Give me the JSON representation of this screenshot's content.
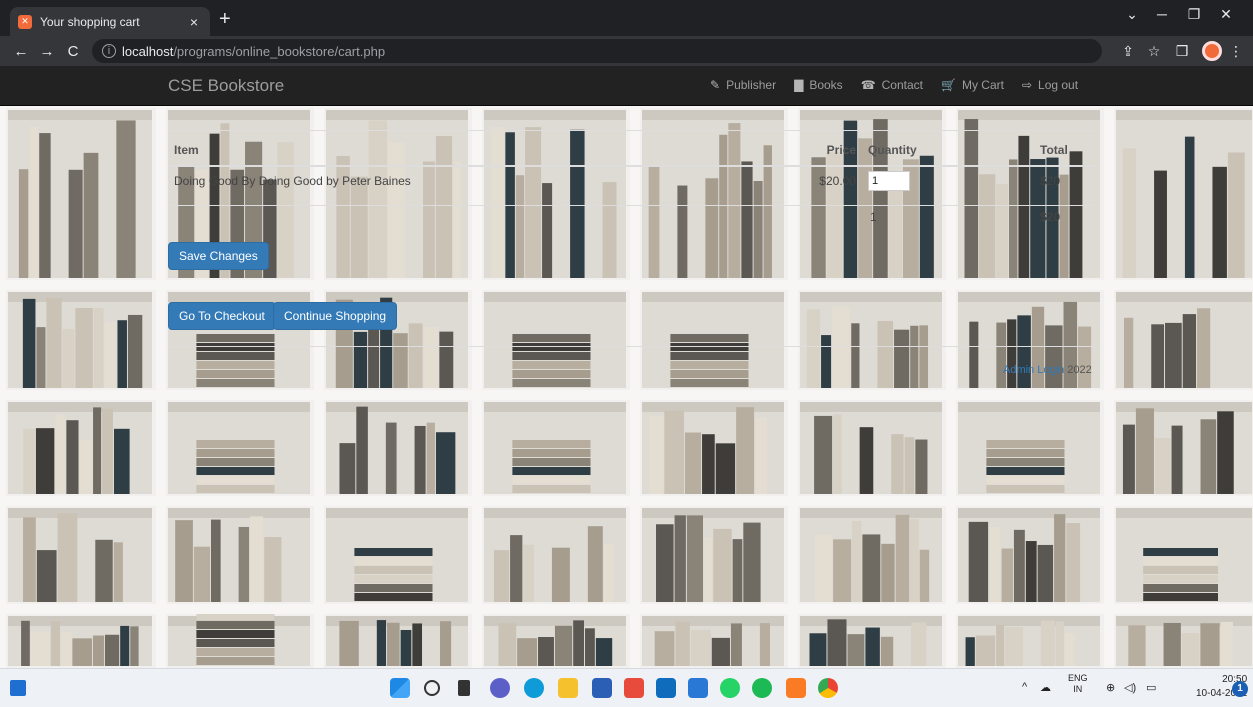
{
  "browser": {
    "tab_title": "Your shopping cart",
    "tab_favicon": "XAMPP",
    "tab_close": "×",
    "new_tab": "+",
    "url_host": "localhost",
    "url_path": "/programs/online_bookstore/cart.php",
    "minimize": "─",
    "restore": "❐",
    "close": "✕",
    "tab_search": "⌄",
    "back": "←",
    "forward": "→",
    "reload": "C",
    "share": "⇪",
    "star": "☆",
    "sidebar": "❒",
    "menu": "⋮"
  },
  "navbar": {
    "brand": "CSE Bookstore",
    "links": [
      {
        "icon": "paperclip-icon",
        "glyph": "✎",
        "label": "Publisher"
      },
      {
        "icon": "book-icon",
        "glyph": "▇",
        "label": "Books"
      },
      {
        "icon": "phone-icon",
        "glyph": "☎",
        "label": "Contact"
      },
      {
        "icon": "cart-icon",
        "glyph": "🛒",
        "label": "My Cart"
      },
      {
        "icon": "logout-icon",
        "glyph": "⇨",
        "label": "Log out"
      }
    ]
  },
  "cart": {
    "headers": {
      "item": "Item",
      "price": "Price",
      "quantity": "Quantity",
      "total": "Total"
    },
    "rows": [
      {
        "item": "Doing Good By Doing Good by Peter Baines",
        "price": "$20.00",
        "quantity": "1",
        "total": "$20"
      }
    ],
    "summary": {
      "quantity": "1",
      "total": "$20"
    },
    "save_label": "Save Changes",
    "checkout_label": "Go To Checkout",
    "continue_label": "Continue Shopping"
  },
  "footer": {
    "link": "Admin Login",
    "year": "2022"
  },
  "taskbar": {
    "lang_top": "ENG",
    "lang_bottom": "IN",
    "time": "20:50",
    "date": "10-04-2022",
    "notifications": "1"
  },
  "colors": {
    "navbar_bg": "#222222",
    "primary_button": "#337ab7",
    "chrome_bg": "#202124"
  }
}
